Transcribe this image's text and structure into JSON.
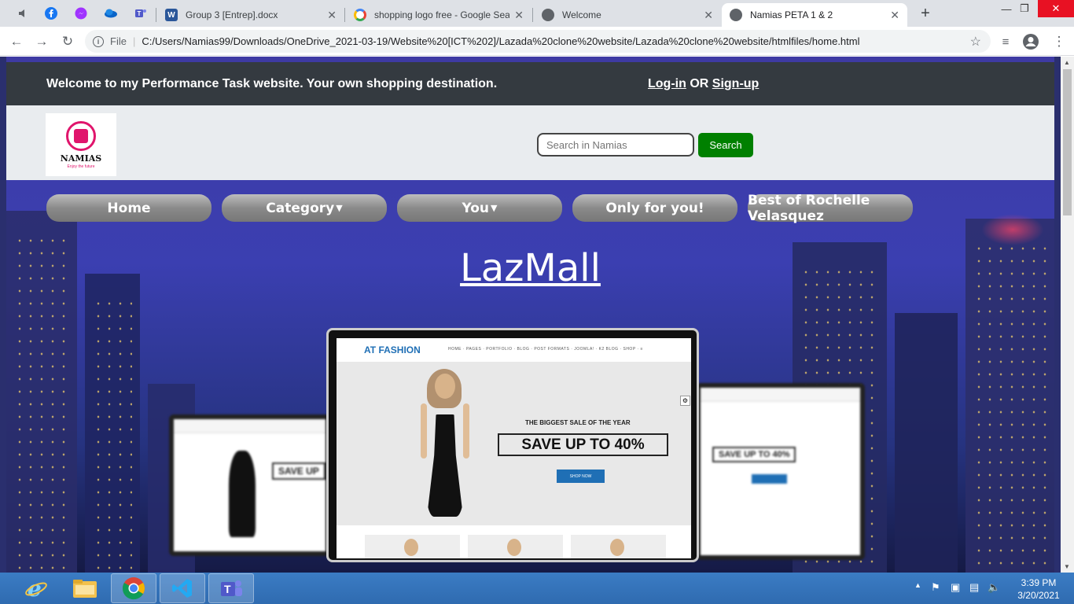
{
  "browser": {
    "tabs": [
      {
        "title": "Group 3 [Entrep].docx",
        "icon": "word-icon"
      },
      {
        "title": "shopping logo free - Google Sea",
        "icon": "google-icon"
      },
      {
        "title": "Welcome",
        "icon": "globe-icon"
      },
      {
        "title": "Namias PETA 1 & 2",
        "icon": "globe-icon",
        "active": true
      }
    ],
    "pinned_tabs": [
      "speaker-icon",
      "facebook-icon",
      "messenger-icon",
      "onedrive-icon",
      "teams-icon"
    ],
    "file_label": "File",
    "url": "C:/Users/Namias99/Downloads/OneDrive_2021-03-19/Website%20[ICT%202]/Lazada%20clone%20website/Lazada%20clone%20website/htmlfiles/home.html"
  },
  "site": {
    "welcome_text": "Welcome to my Performance Task website. Your own shopping destination.",
    "login": "Log-in",
    "or": "OR",
    "signup": "Sign-up",
    "logo_name": "NAMIAS",
    "logo_tagline": "Enjoy the future",
    "search_placeholder": "Search in Namias",
    "search_button": "Search",
    "nav": [
      {
        "label": "Home"
      },
      {
        "label": "Category",
        "dropdown": true
      },
      {
        "label": "You",
        "dropdown": true
      },
      {
        "label": "Only for you!"
      },
      {
        "label": "Best of Rochelle Velasquez"
      }
    ],
    "heading": "LazMall",
    "mockup": {
      "logo": "AT FASHION",
      "menu": "HOME · PAGES · PORTFOLIO · BLOG · POST FORMATS · JOOMLA! · K2 BLOG · SHOP · ≡",
      "biggest": "THE BIGGEST SALE OF THE YEAR",
      "save": "SAVE UP TO 40%",
      "shop": "SHOP NOW",
      "left_save": "SAVE UP",
      "right_save": "SAVE UP TO 40%"
    }
  },
  "taskbar": {
    "apps": [
      "ie-icon",
      "file-explorer-icon",
      "chrome-icon",
      "vscode-icon",
      "teams-icon"
    ],
    "time": "3:39 PM",
    "date": "3/20/2021"
  },
  "colors": {
    "accent_pink": "#e0156c",
    "search_green": "#008000",
    "topbar": "#343a40",
    "header_bg": "#e9ecef"
  }
}
